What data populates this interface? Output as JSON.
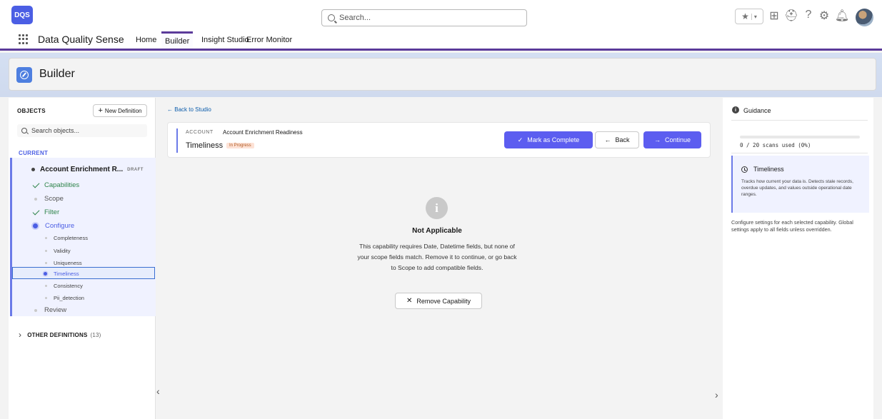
{
  "header": {
    "logo_text": "DQS",
    "search_placeholder": "Search...",
    "icons": [
      "favorites-star-icon",
      "favorites-dropdown-icon",
      "add-icon",
      "trailhead-icon",
      "help-icon",
      "setup-gear-icon",
      "notifications-bell-icon",
      "user-avatar"
    ]
  },
  "nav": {
    "app_name": "Data Quality Sense",
    "items": [
      {
        "label": "Home",
        "active": false
      },
      {
        "label": "Builder",
        "active": true
      },
      {
        "label": "Insight Studio",
        "active": false
      },
      {
        "label": "Error Monitor",
        "active": false
      }
    ]
  },
  "page": {
    "title": "Builder"
  },
  "left": {
    "objects_label": "OBJECTS",
    "new_definition": "New Definition",
    "search_placeholder": "Search objects...",
    "current_label": "CURRENT",
    "definition_name": "Account Enrichment R...",
    "definition_status": "DRAFT",
    "steps": [
      {
        "label": "Capabilities",
        "state": "done"
      },
      {
        "label": "Scope",
        "state": "pending"
      },
      {
        "label": "Filter",
        "state": "done"
      },
      {
        "label": "Configure",
        "state": "current"
      }
    ],
    "capabilities": [
      {
        "label": "Completeness",
        "selected": false
      },
      {
        "label": "Validity",
        "selected": false
      },
      {
        "label": "Uniqueness",
        "selected": false
      },
      {
        "label": "Timeliness",
        "selected": true
      },
      {
        "label": "Consistency",
        "selected": false
      },
      {
        "label": "Pii_detection",
        "selected": false
      }
    ],
    "review_label": "Review",
    "other_label": "OTHER DEFINITIONS",
    "other_count": "(13)"
  },
  "center": {
    "back_link": "Back to Studio",
    "object_tag": "ACCOUNT",
    "definition_title": "Account Enrichment Readiness",
    "capability_title": "Timeliness",
    "status_badge": "In Progress",
    "mark_complete": "Mark as Complete",
    "back": "Back",
    "continue": "Continue",
    "na_title": "Not Applicable",
    "na_desc": "This capability requires Date, Datetime fields, but none of your scope fields match. Remove it to continue, or go back to Scope to add compatible fields.",
    "remove_button": "Remove Capability"
  },
  "right": {
    "guidance_title": "Guidance",
    "scans_text": "0 / 20 scans used (0%)",
    "scans_fraction": 0,
    "capability_title": "Timeliness",
    "capability_desc": "Tracks how current your data is. Detects stale records, overdue updates, and values outside operational date ranges.",
    "configure_note": "Configure settings for each selected capability. Global settings apply to all fields unless overridden."
  },
  "colors": {
    "accent": "#5c5df0",
    "nav_underline": "#5b3a9a",
    "success": "#2e844a",
    "badge_bg": "#fde2d6"
  }
}
